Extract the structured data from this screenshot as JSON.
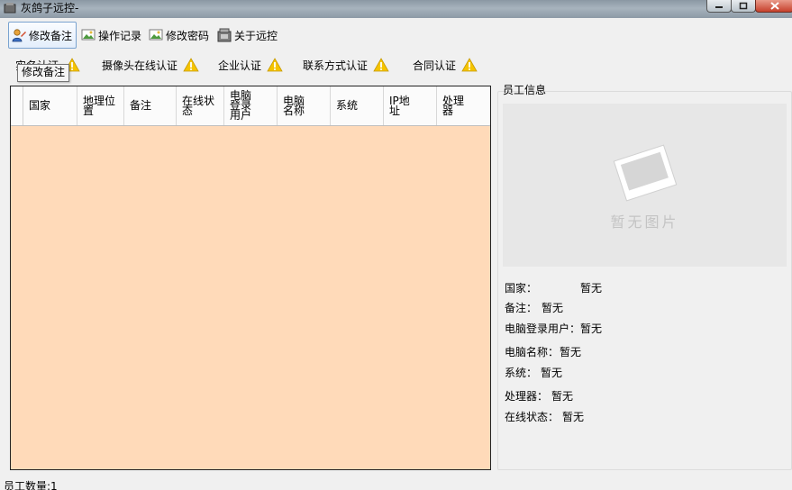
{
  "window": {
    "title": "灰鸽子远控-"
  },
  "toolbar": {
    "edit_note": "修改备注",
    "operation_log": "操作记录",
    "change_password": "修改密码",
    "about": "关于远控"
  },
  "tooltip": "修改备注",
  "auth": [
    "实名认证",
    "摄像头在线认证",
    "企业认证",
    "联系方式认证",
    "合同认证"
  ],
  "grid": {
    "columns": [
      "国家",
      "地理位置",
      "备注",
      "在线状态",
      "电脑登录用户",
      "电脑名称",
      "系统",
      "IP地址",
      "处理器"
    ]
  },
  "panel": {
    "title": "员工信息",
    "photo_placeholder": "暂无图片",
    "fields": {
      "country_label": "国家：",
      "country_value": "暂无",
      "note_label": "备注：",
      "note_value": "暂无",
      "login_user_label": "电脑登录用户：",
      "login_user_value": "暂无",
      "pc_name_label": "电脑名称：",
      "pc_name_value": "暂无",
      "os_label": "系统：",
      "os_value": "暂无",
      "cpu_label": "处理器：",
      "cpu_value": "暂无",
      "online_label": "在线状态：",
      "online_value": "暂无"
    }
  },
  "status": {
    "employee_count": "员工数量:1"
  },
  "colors": {
    "grid_background": "#ffdab9",
    "warning": "#f5c400"
  }
}
